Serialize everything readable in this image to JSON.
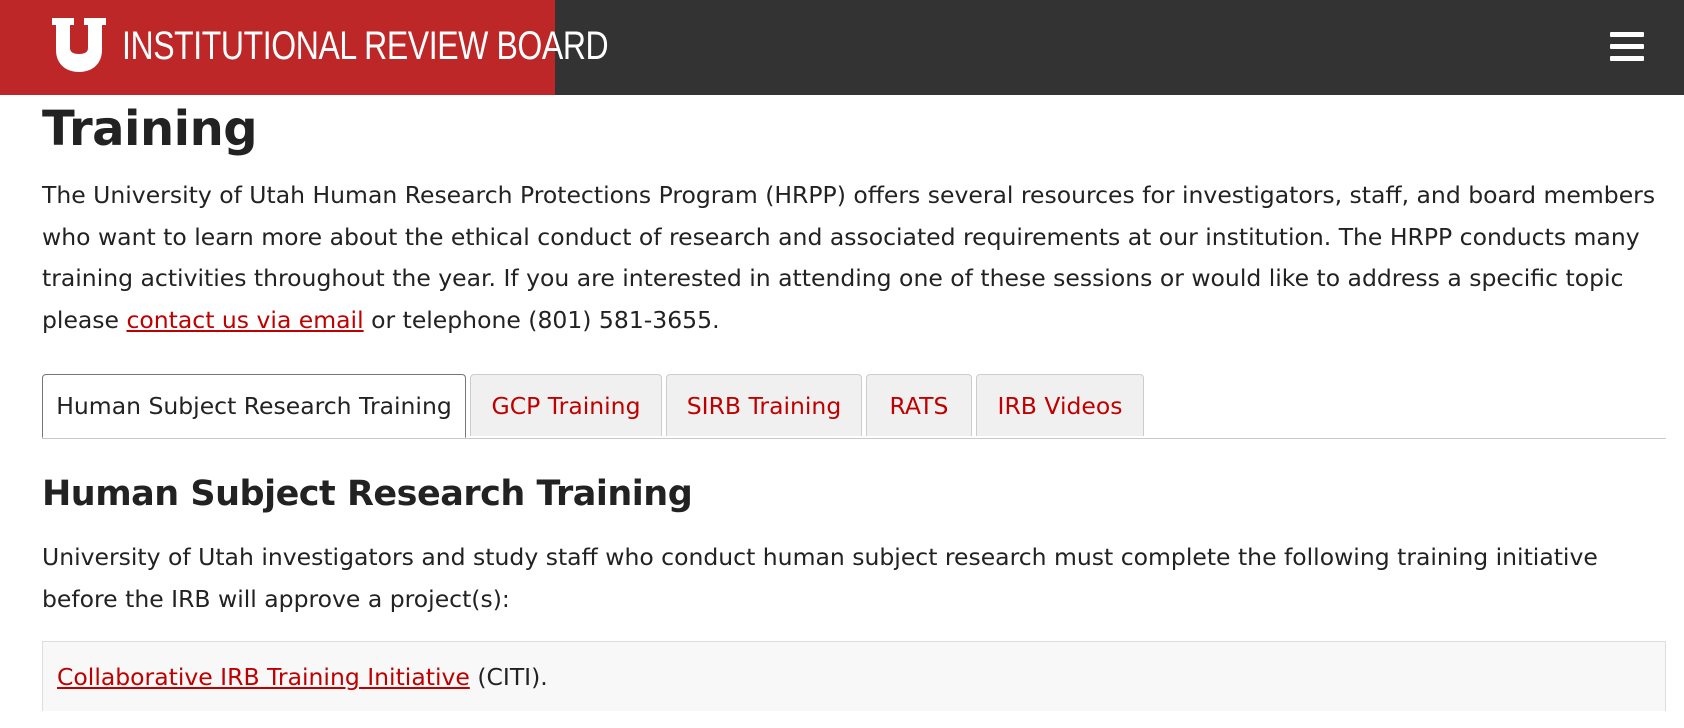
{
  "header": {
    "site_title": "INSTITUTIONAL REVIEW BOARD",
    "logo_icon": "university-u-logo",
    "menu_icon": "hamburger-menu-icon",
    "brand_color": "#be2727",
    "bar_color": "#333333"
  },
  "page": {
    "title": "Training",
    "intro_text": "The University of Utah Human Research Protections Program (HRPP) offers several resources for investigators, staff, and board members who want to learn more about the ethical conduct of research and associated requirements at our institution. The HRPP conducts many training activities throughout the year. If you are interested in attending one of these sessions or would like to address a specific topic please ",
    "intro_link": "contact us via email",
    "intro_tail": " or telephone (801) 581-3655.",
    "link_color": "#be0000"
  },
  "tabs": [
    {
      "label": "Human Subject Research Training",
      "active": true
    },
    {
      "label": "GCP Training",
      "active": false
    },
    {
      "label": "SIRB Training",
      "active": false
    },
    {
      "label": "RATS",
      "active": false
    },
    {
      "label": "IRB Videos",
      "active": false
    }
  ],
  "section": {
    "title": "Human Subject Research Training",
    "text": "University of Utah investigators and study staff who conduct human subject research must complete the following training initiative before the IRB will approve a project(s):",
    "callout_link": "Collaborative IRB Training Initiative",
    "callout_tail": " (CITI)."
  }
}
